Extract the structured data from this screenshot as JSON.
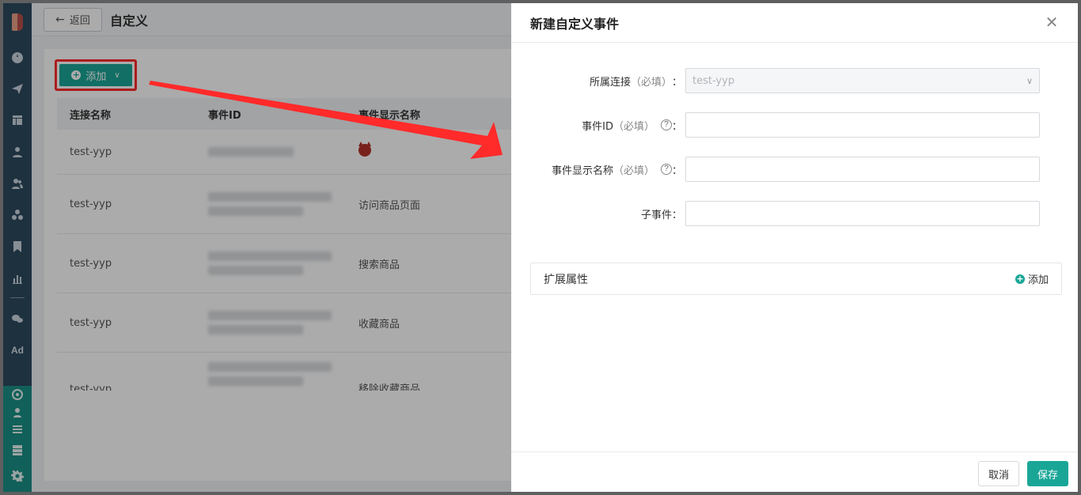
{
  "header": {
    "back_label": "返回",
    "title": "自定义"
  },
  "sidebar": {
    "icons": [
      "dashboard-icon",
      "send-icon",
      "layout-icon",
      "user-icon",
      "users-icon",
      "cluster-icon",
      "tag-icon",
      "bar-chart-icon",
      "wechat-icon",
      "ad-icon",
      "target-icon",
      "team-icon",
      "list-icon",
      "server-icon",
      "gear-icon"
    ],
    "ad_label": "Ad"
  },
  "toolbar": {
    "add_label": "添加"
  },
  "table": {
    "columns": [
      "连接名称",
      "事件ID",
      "事件显示名称"
    ],
    "rows": [
      {
        "connection": "test-yyp",
        "display": ""
      },
      {
        "connection": "test-yyp",
        "display": "访问商品页面"
      },
      {
        "connection": "test-yyp",
        "display": "搜索商品"
      },
      {
        "connection": "test-yyp",
        "display": "收藏商品"
      },
      {
        "connection": "test-yyp",
        "display": "移除收藏商品"
      }
    ]
  },
  "drawer": {
    "title": "新建自定义事件",
    "fields": {
      "connection": {
        "label": "所属连接",
        "req": "（必填）",
        "value": "test-yyp"
      },
      "event_id": {
        "label": "事件ID",
        "req": "（必填）",
        "value": ""
      },
      "display_name": {
        "label": "事件显示名称",
        "req": "（必填）",
        "value": ""
      },
      "sub_event": {
        "label": "子事件",
        "value": ""
      }
    },
    "ext_title": "扩展属性",
    "ext_add": "添加",
    "cancel": "取消",
    "save": "保存"
  },
  "colors": {
    "accent": "#1aa697",
    "annotation": "#ff2a2a"
  }
}
